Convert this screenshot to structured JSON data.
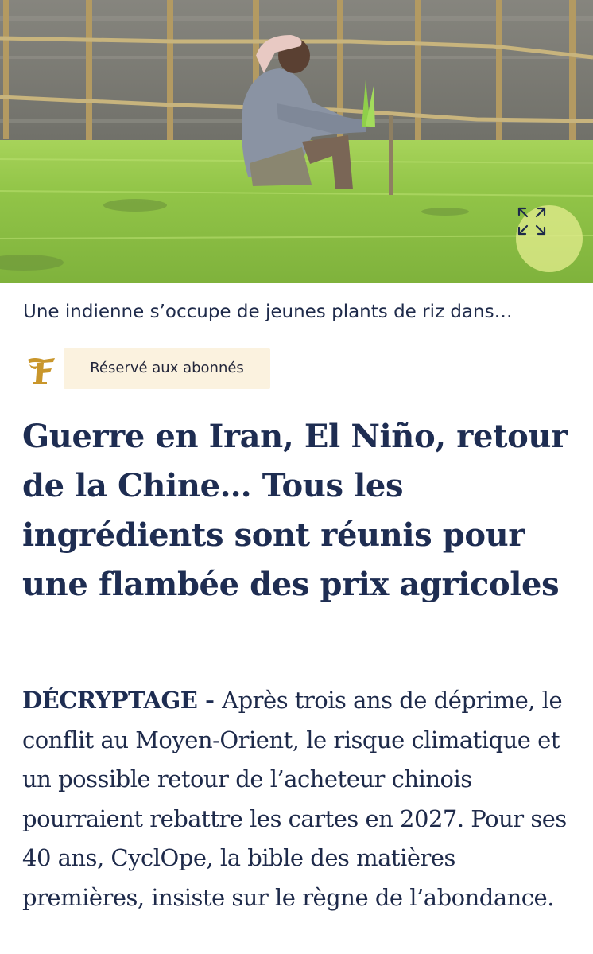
{
  "photo": {
    "expand_icon": "expand-icon",
    "description_icon": "photo"
  },
  "caption": {
    "text": "Une indienne s’occupe de jeunes plants de riz dans…"
  },
  "badge": {
    "logo_icon": "le-figaro-f-logo",
    "label": "Réservé aux abonnés",
    "background_color": "#fbf2df"
  },
  "article": {
    "title": "Guerre en Iran, El Niño, retour de la Chine… Tous les ingrédients sont réunis pour une flambée des prix agricoles",
    "kicker": "DÉCRYPTAGE - ",
    "lead": "Après trois ans de déprime, le conflit au Moyen-Orient, le risque climatique et un possible retour de l’acheteur chinois pourraient rebattre les cartes en 2027. Pour ses 40 ans, CyclOpe, la bible des matières premières, insiste sur le règne de l’abondance."
  },
  "colors": {
    "headline": "#1e2d52",
    "text": "#1e2a4a",
    "logo_gold": "#c9962b",
    "expand_button": "#e1ec8c"
  }
}
